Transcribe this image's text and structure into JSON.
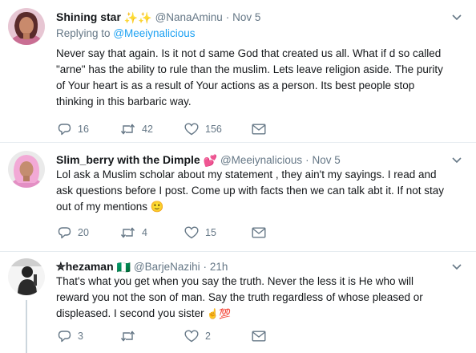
{
  "tweets": [
    {
      "display_name": "Shining star",
      "name_emoji": "✨✨",
      "handle": "@NanaAminu",
      "separator": "·",
      "date": "Nov 5",
      "replying_prefix": "Replying to",
      "replying_handle": "@Meeiynalicious",
      "lines": [
        "Never say that again. Is it not d same God that created us all. What if d so called",
        "\"arne\" has the ability to rule than the muslim. Lets leave religion aside. The purity",
        "of Your heart is as a result of Your actions as a person. Its best people stop",
        "thinking in this barbaric way."
      ],
      "replies": "16",
      "retweets": "42",
      "likes": "156"
    },
    {
      "display_name": "Slim_berry with the Dimple",
      "name_emoji": "💕",
      "handle": "@Meeiynalicious",
      "separator": "·",
      "date": "Nov 5",
      "lines": [
        "Lol ask a Muslim scholar about my statement , they ain't my sayings. I read and",
        "ask questions before I post. Come up with facts then we can talk abt it. If not stay",
        "out of my mentions"
      ],
      "trailing_emoji": "🙂",
      "replies": "20",
      "retweets": "4",
      "likes": "15"
    },
    {
      "display_name": "✮hezaman",
      "name_emoji": "🇳🇬",
      "handle": "@BarjeNazihi",
      "separator": "·",
      "date": "21h",
      "lines": [
        "That's what you get when you say the truth. Never the less it is He who will",
        "reward you not the son of man. Say the truth regardless of whose pleased or",
        "displeased. I second you sister"
      ],
      "trailing_emoji": "☝💯",
      "replies": "3",
      "retweets": "",
      "likes": "2"
    }
  ],
  "colors": {
    "text": "#14171a",
    "muted": "#657786",
    "link": "#1da1f2",
    "divider": "#e6ecf0"
  },
  "icons": [
    "reply-icon",
    "retweet-icon",
    "like-icon",
    "message-icon",
    "chevron-down-icon"
  ]
}
